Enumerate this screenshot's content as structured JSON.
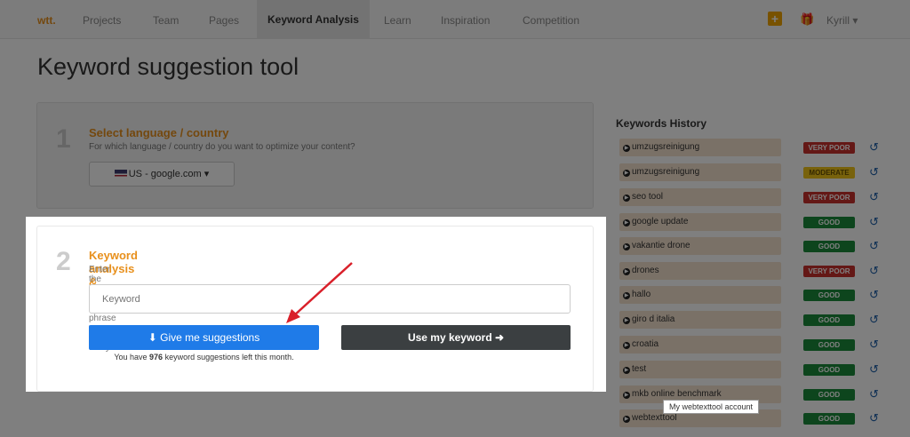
{
  "nav": {
    "logo": "wtt.",
    "items": [
      "Projects",
      "Team",
      "Pages",
      "Keyword Analysis",
      "Learn",
      "Inspiration",
      "Competition"
    ],
    "plus": "+",
    "user": "Kyrill ▾"
  },
  "page_title": "Keyword suggestion tool",
  "step1": {
    "number": "1",
    "title": "Select language / country",
    "subtitle": "For which language / country do you want to optimize your content?",
    "language_value": "US - google.com ▾"
  },
  "step2": {
    "number": "2",
    "title": "Keyword analysis & selection",
    "subtitle": "Enter the keyword or keyword phrase you want to analyse.",
    "keyword_placeholder": "Keyword",
    "suggest_button": "Give me suggestions",
    "use_button": "Use my keyword",
    "note_prefix": "You have ",
    "note_count": "976",
    "note_suffix": " keyword suggestions left this month."
  },
  "history": {
    "title": "Keywords History",
    "rows": [
      {
        "keyword": "umzugsreinigung",
        "badge": "VERY POOR"
      },
      {
        "keyword": "umzugsreinigung",
        "badge": "MODERATE"
      },
      {
        "keyword": "seo tool",
        "badge": "VERY POOR"
      },
      {
        "keyword": "google update",
        "badge": "GOOD"
      },
      {
        "keyword": "vakantie drone",
        "badge": "GOOD"
      },
      {
        "keyword": "drones",
        "badge": "VERY POOR"
      },
      {
        "keyword": "hallo",
        "badge": "GOOD"
      },
      {
        "keyword": "giro d italia",
        "badge": "GOOD"
      },
      {
        "keyword": "croatia",
        "badge": "GOOD"
      },
      {
        "keyword": "test",
        "badge": "GOOD"
      },
      {
        "keyword": "mkb online benchmark",
        "badge": "GOOD"
      },
      {
        "keyword": "webtexttool",
        "badge": "GOOD"
      }
    ],
    "badge_colors": {
      "VERY POOR": "#c9302c",
      "MODERATE": "#f0c419",
      "GOOD": "#1a8a3a"
    }
  },
  "tooltip": "My webtexttool account"
}
